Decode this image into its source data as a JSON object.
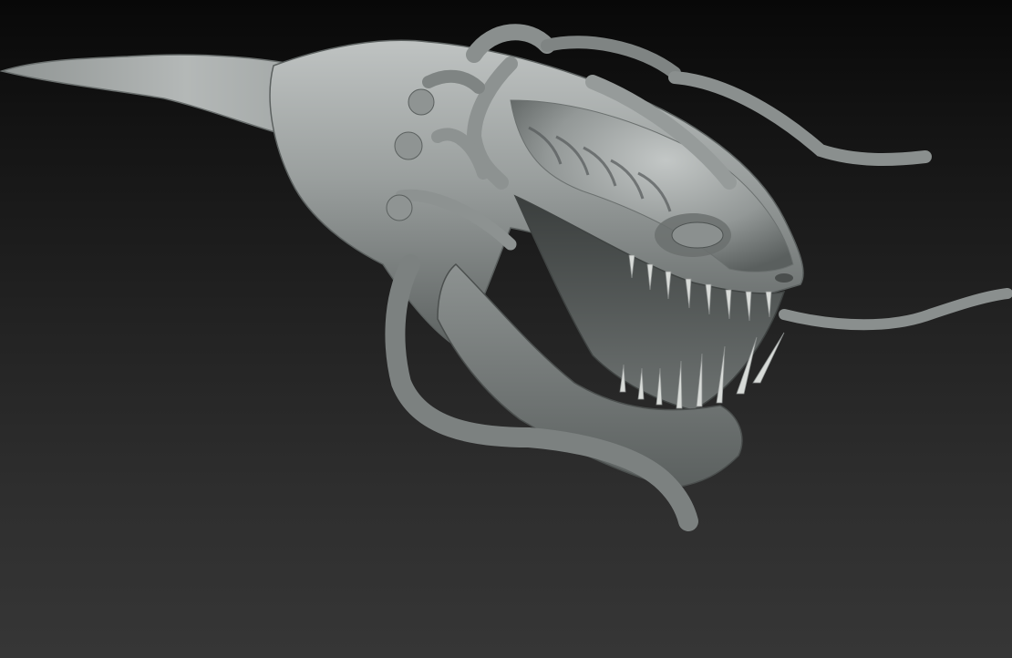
{
  "scene": {
    "subject_icon": "creature-sculpt-icon",
    "colors": {
      "background_top": "#080808",
      "background_bottom": "#363636",
      "clay_highlight": "#b9bdbc",
      "clay_mid": "#8e9392",
      "clay_shadow": "#4a4e4d",
      "mouth_interior": "#2f3231",
      "teeth": "#d8dbd8"
    }
  }
}
